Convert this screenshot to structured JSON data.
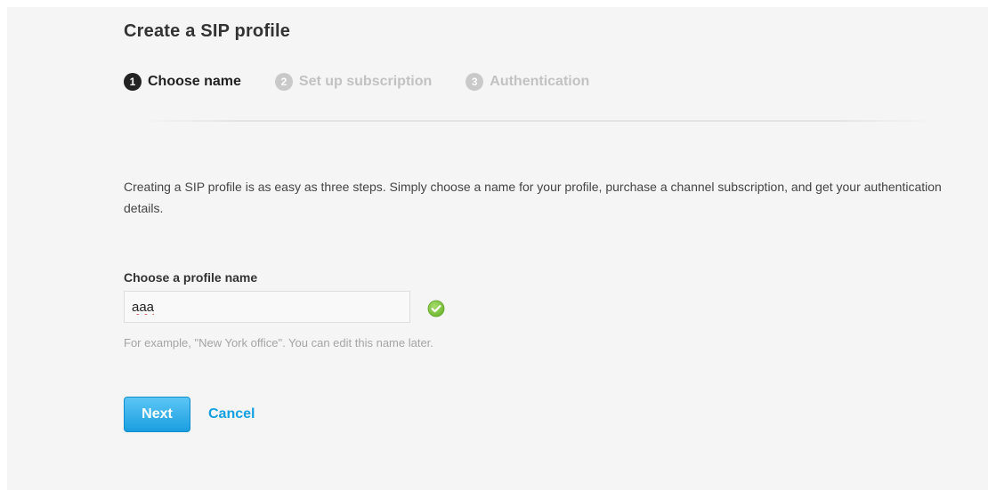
{
  "page": {
    "title": "Create a SIP profile"
  },
  "steps": [
    {
      "number": "1",
      "label": "Choose name",
      "state": "active"
    },
    {
      "number": "2",
      "label": "Set up subscription",
      "state": "inactive"
    },
    {
      "number": "3",
      "label": "Authentication",
      "state": "inactive"
    }
  ],
  "intro": {
    "text": "Creating a SIP profile is as easy as three steps. Simply choose a name for your profile, purchase a channel subscription, and get your authentication details."
  },
  "form": {
    "profile_name_label": "Choose a profile name",
    "profile_name_value": "aaa",
    "valid_icon": "check-circle-icon",
    "hint": "For example, \"New York office\". You can edit this name later."
  },
  "actions": {
    "next_label": "Next",
    "cancel_label": "Cancel"
  },
  "colors": {
    "accent": "#1a9ee0",
    "link": "#12a0e0",
    "success": "#7cc142",
    "active_step": "#222222",
    "inactive_step": "#c2c2c2"
  }
}
